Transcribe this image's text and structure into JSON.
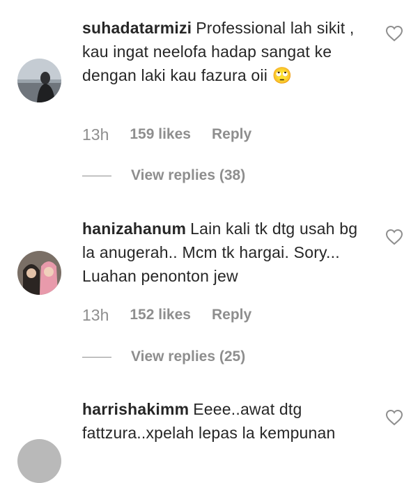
{
  "comments": [
    {
      "username": "suhadatarmizi",
      "text": "Professional lah sikit , kau ingat neelofa hadap sangat ke dengan laki kau fazura oii",
      "emoji": "🙄",
      "time": "13h",
      "likes": "159 likes",
      "reply": "Reply",
      "view_replies": "View replies (38)"
    },
    {
      "username": "hanizahanum",
      "text": "Lain kali tk dtg usah bg la anugerah.. Mcm tk hargai. Sory... Luahan penonton jew",
      "time": "13h",
      "likes": "152 likes",
      "reply": "Reply",
      "view_replies": "View replies (25)"
    },
    {
      "username": "harrishakimm",
      "text": "Eeee..awat dtg fattzura..xpelah lepas la kempunan"
    }
  ],
  "icons": {
    "like": "heart-outline-icon"
  },
  "colors": {
    "text": "#262626",
    "secondary": "#8e8e8e"
  }
}
